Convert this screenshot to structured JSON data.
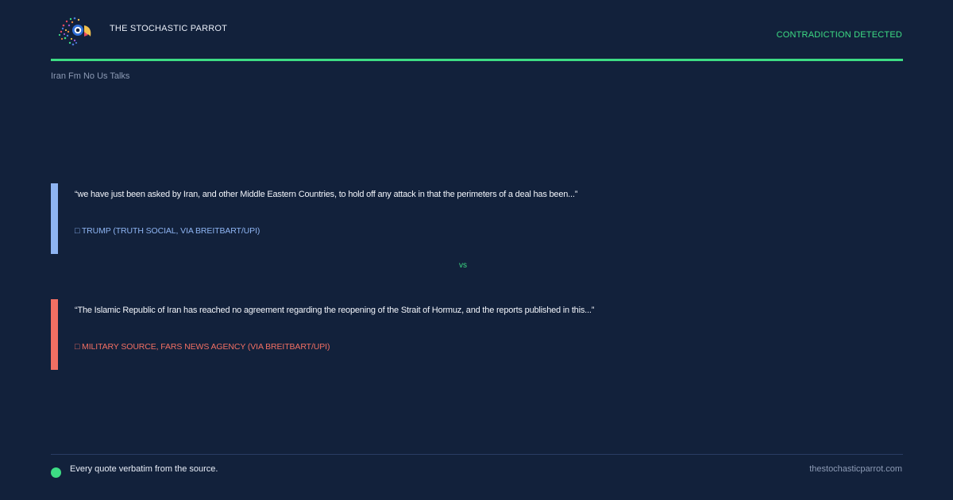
{
  "header": {
    "brand": "THE STOCHASTIC PARROT",
    "status": "CONTRADICTION DETECTED",
    "logo_icon": "parrot-logo"
  },
  "topic": "Iran Fm No Us Talks",
  "quotes": [
    {
      "text": "“we have just been asked by Iran, and other Middle Eastern Countries, to hold off any attack in that the perimeters of a deal has been...”",
      "source": "□ TRUMP (TRUTH SOCIAL, VIA BREITBART/UPI)",
      "color": "#8eb4f2"
    },
    {
      "text": "“The Islamic Republic of Iran has reached no agreement regarding the reopening of the Strait of Hormuz, and the reports published in this...”",
      "source": "□ MILITARY SOURCE, FARS NEWS AGENCY (VIA BREITBART/UPI)",
      "color": "#f26f63"
    }
  ],
  "vs_label": "vs",
  "footer": {
    "note": "Every quote verbatim from the source.",
    "site": "thestochasticparrot.com"
  },
  "colors": {
    "background": "#12213b",
    "accent": "#3ddc84"
  }
}
